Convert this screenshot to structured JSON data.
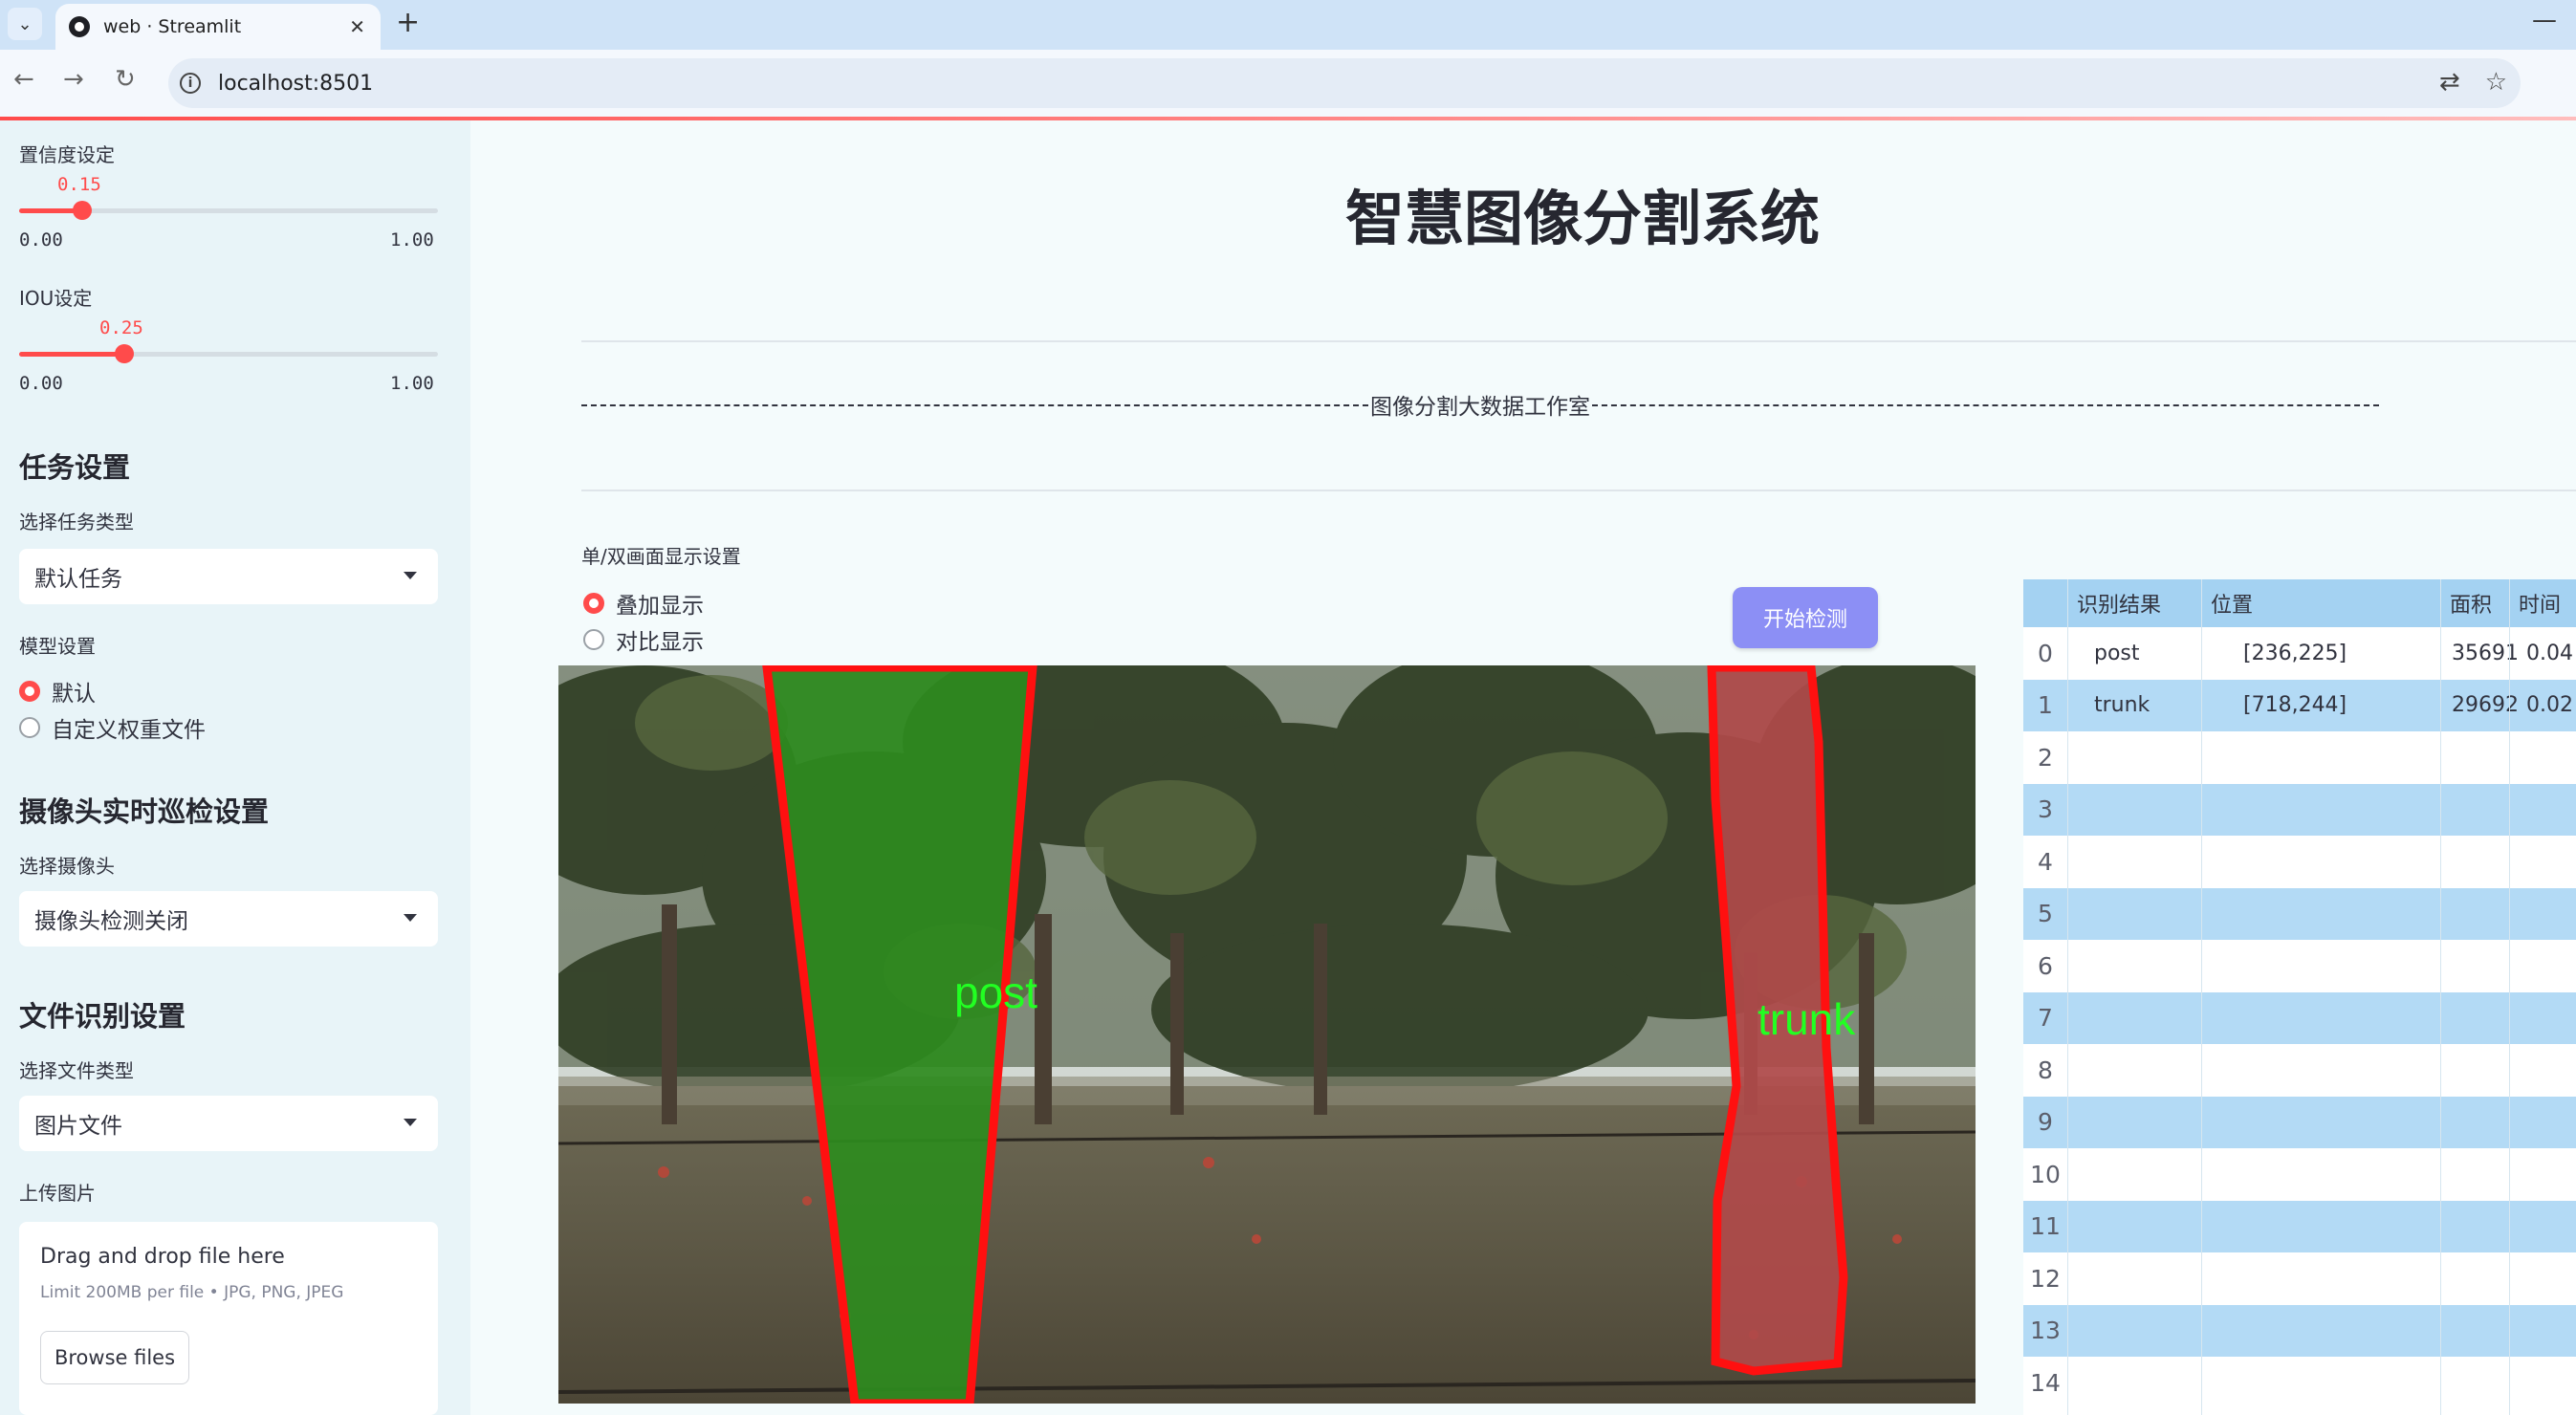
{
  "browser": {
    "tab_title": "web · Streamlit",
    "url": "localhost:8501"
  },
  "sidebar": {
    "confidence": {
      "label": "置信度设定",
      "value": "0.15",
      "min": "0.00",
      "max": "1.00",
      "fraction": 0.15
    },
    "iou": {
      "label": "IOU设定",
      "value": "0.25",
      "min": "0.00",
      "max": "1.00",
      "fraction": 0.25
    },
    "task_header": "任务设置",
    "task_type_label": "选择任务类型",
    "task_type_value": "默认任务",
    "model_label": "模型设置",
    "model_options": [
      "默认",
      "自定义权重文件"
    ],
    "model_selected": "默认",
    "camera_header": "摄像头实时巡检设置",
    "camera_label": "选择摄像头",
    "camera_value": "摄像头检测关闭",
    "file_header": "文件识别设置",
    "file_type_label": "选择文件类型",
    "file_type_value": "图片文件",
    "upload_label": "上传图片",
    "upload": {
      "title": "Drag and drop file here",
      "limit": "Limit 200MB per file • JPG, PNG, JPEG",
      "button": "Browse files"
    }
  },
  "main": {
    "title": "智慧图像分割系统",
    "studio": "图像分割大数据工作室",
    "display_mode_label": "单/双画面显示设置",
    "display_modes": [
      "叠加显示",
      "对比显示"
    ],
    "display_selected": "叠加显示",
    "detect_button": "开始检测",
    "image_labels": {
      "post": "post",
      "trunk": "trunk"
    }
  },
  "colors": {
    "accent": "#ff4b4b",
    "button": "#8c8ff5",
    "post_mask": "#2e8b1e",
    "trunk_mask": "#b04a4a",
    "label_text": "#22ff22"
  },
  "table": {
    "headers": [
      "识别结果",
      "位置",
      "面积",
      "时间"
    ],
    "rows": [
      {
        "idx": "0",
        "result": "post",
        "position": "[236,225]",
        "area": "35691",
        "time": "0.04"
      },
      {
        "idx": "1",
        "result": "trunk",
        "position": "[718,244]",
        "area": "29692",
        "time": "0.02"
      },
      {
        "idx": "2"
      },
      {
        "idx": "3"
      },
      {
        "idx": "4"
      },
      {
        "idx": "5"
      },
      {
        "idx": "6"
      },
      {
        "idx": "7"
      },
      {
        "idx": "8"
      },
      {
        "idx": "9"
      },
      {
        "idx": "10"
      },
      {
        "idx": "11"
      },
      {
        "idx": "12"
      },
      {
        "idx": "13"
      },
      {
        "idx": "14"
      }
    ]
  }
}
